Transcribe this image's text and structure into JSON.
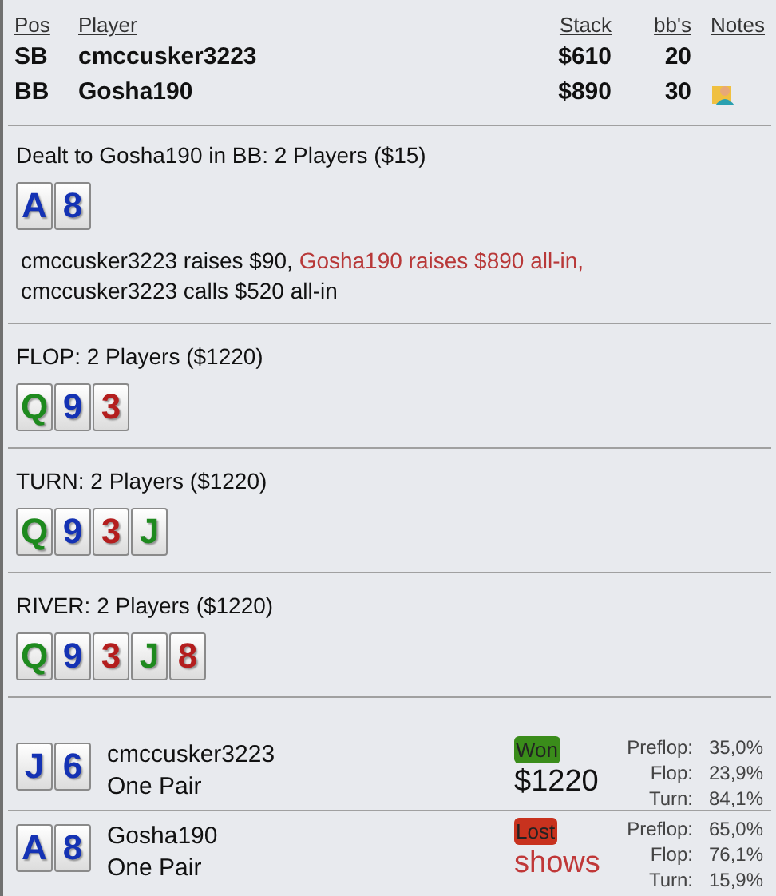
{
  "players_table": {
    "columns": [
      "Pos",
      "Player",
      "Stack",
      "bb's",
      "Notes"
    ],
    "rows": [
      {
        "pos": "SB",
        "player": "cmccusker3223",
        "stack": "$610",
        "bbs": "20",
        "has_note": false
      },
      {
        "pos": "BB",
        "player": "Gosha190",
        "stack": "$890",
        "bbs": "30",
        "has_note": true
      }
    ]
  },
  "preflop": {
    "title": "Dealt to Gosha190 in BB: 2 Players ($15)",
    "cards": [
      {
        "rank": "A",
        "color": "#1432b4"
      },
      {
        "rank": "8",
        "color": "#1432b4"
      }
    ],
    "action_lines": [
      [
        {
          "text": "cmccusker3223 raises $90, ",
          "hero": false
        },
        {
          "text": "Gosha190 raises $890 all-in,",
          "hero": true
        }
      ],
      [
        {
          "text": "cmccusker3223 calls $520 all-in",
          "hero": false
        }
      ]
    ]
  },
  "streets": [
    {
      "title": "FLOP: 2 Players ($1220)",
      "cards": [
        {
          "rank": "Q",
          "color": "#1e8a1e"
        },
        {
          "rank": "9",
          "color": "#1432b4"
        },
        {
          "rank": "3",
          "color": "#b41e1e"
        }
      ]
    },
    {
      "title": "TURN: 2 Players ($1220)",
      "cards": [
        {
          "rank": "Q",
          "color": "#1e8a1e"
        },
        {
          "rank": "9",
          "color": "#1432b4"
        },
        {
          "rank": "3",
          "color": "#b41e1e"
        },
        {
          "rank": "J",
          "color": "#1e8a1e"
        }
      ]
    },
    {
      "title": "RIVER: 2 Players ($1220)",
      "cards": [
        {
          "rank": "Q",
          "color": "#1e8a1e"
        },
        {
          "rank": "9",
          "color": "#1432b4"
        },
        {
          "rank": "3",
          "color": "#b41e1e"
        },
        {
          "rank": "J",
          "color": "#1e8a1e"
        },
        {
          "rank": "8",
          "color": "#b41e1e"
        }
      ]
    }
  ],
  "results": [
    {
      "cards": [
        {
          "rank": "J",
          "color": "#1432b4"
        },
        {
          "rank": "6",
          "color": "#1432b4"
        }
      ],
      "player": "cmccusker3223",
      "hand": "One Pair",
      "kind": "won",
      "badge": "Won",
      "amount": "$1220",
      "equity": [
        {
          "label": "Preflop:",
          "value": "35,0%"
        },
        {
          "label": "Flop:",
          "value": "23,9%"
        },
        {
          "label": "Turn:",
          "value": "84,1%"
        }
      ]
    },
    {
      "cards": [
        {
          "rank": "A",
          "color": "#1432b4"
        },
        {
          "rank": "8",
          "color": "#1432b4"
        }
      ],
      "player": "Gosha190",
      "hand": "One Pair",
      "kind": "lost",
      "badge": "Lost",
      "amount": "shows",
      "equity": [
        {
          "label": "Preflop:",
          "value": "65,0%"
        },
        {
          "label": "Flop:",
          "value": "76,1%"
        },
        {
          "label": "Turn:",
          "value": "15,9%"
        }
      ]
    }
  ]
}
